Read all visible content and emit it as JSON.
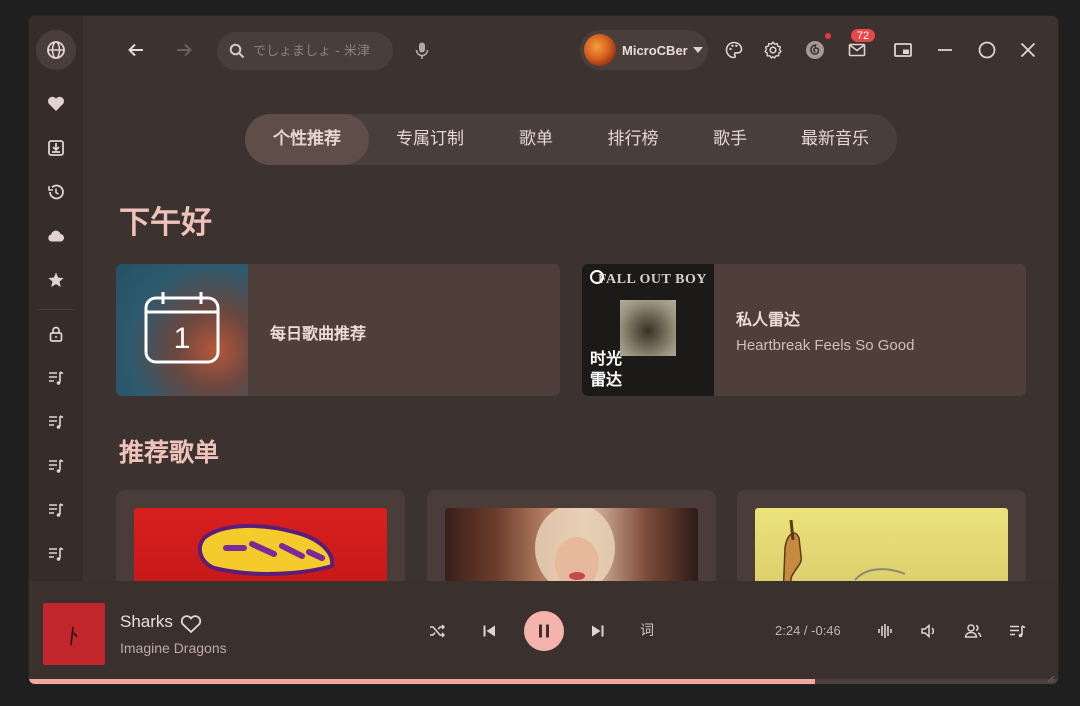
{
  "search": {
    "placeholder": "でしょましょ - 米津"
  },
  "user": {
    "name": "MicroCBer"
  },
  "messages": {
    "badge": "72"
  },
  "tabs": [
    "个性推荐",
    "专属订制",
    "歌单",
    "排行榜",
    "歌手",
    "最新音乐"
  ],
  "greeting": "下午好",
  "daily": {
    "title": "每日歌曲推荐",
    "day": "1"
  },
  "radar": {
    "title": "私人雷达",
    "subtitle": "Heartbreak Feels So Good",
    "cover_text": "时光\n雷达",
    "cover_line1": "时光",
    "cover_line2": "雷达",
    "cover_band": "FALL OUT BOY"
  },
  "playlists": {
    "title": "推荐歌单"
  },
  "player": {
    "title": "Sharks",
    "artist": "Imagine Dragons",
    "time": "2:24 / -0:46",
    "lyric_label": "词",
    "progress": 0.764
  },
  "colors": {
    "accent": "#f4b4ad",
    "badge": "#e54848",
    "background": "#3c3230"
  },
  "icons": {
    "sidebar": [
      "globe-icon",
      "heart-icon",
      "download-icon",
      "history-icon",
      "cloud-icon",
      "star-icon",
      "lock-icon",
      "playlist-icon",
      "playlist-icon",
      "playlist-icon",
      "playlist-icon",
      "playlist-icon"
    ]
  }
}
